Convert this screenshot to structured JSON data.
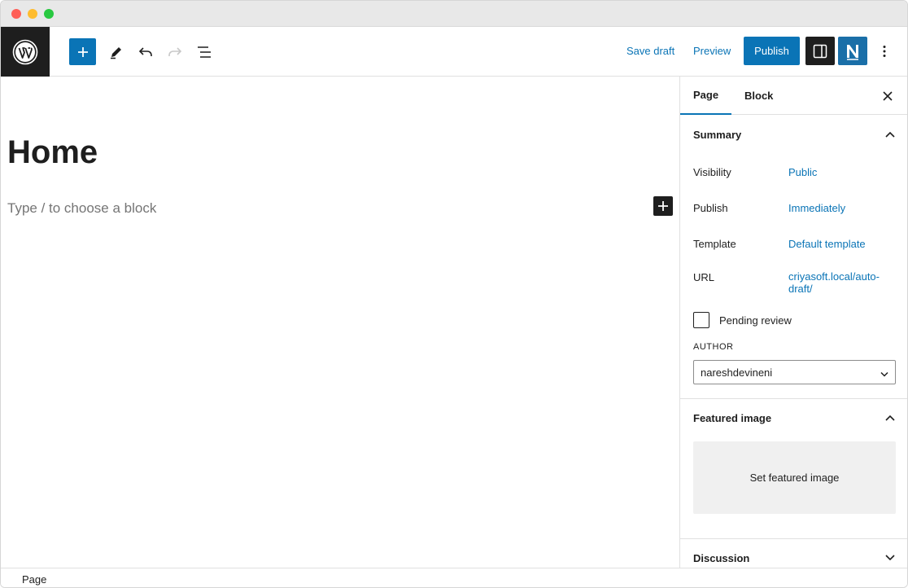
{
  "toolbar": {
    "save_draft": "Save draft",
    "preview": "Preview",
    "publish": "Publish"
  },
  "editor": {
    "title": "Home",
    "placeholder": "Type / to choose a block"
  },
  "sidebar": {
    "tabs": [
      {
        "label": "Page",
        "active": true
      },
      {
        "label": "Block",
        "active": false
      }
    ],
    "summary": {
      "heading": "Summary",
      "rows": [
        {
          "label": "Visibility",
          "value": "Public"
        },
        {
          "label": "Publish",
          "value": "Immediately"
        },
        {
          "label": "Template",
          "value": "Default template"
        },
        {
          "label": "URL",
          "value": "criyasoft.local/auto-draft/"
        }
      ],
      "pending_review": "Pending review",
      "author_label": "AUTHOR",
      "author_value": "nareshdevineni"
    },
    "featured_image": {
      "heading": "Featured image",
      "button": "Set featured image"
    },
    "discussion": {
      "heading": "Discussion"
    }
  },
  "statusbar": {
    "crumb": "Page"
  },
  "colors": {
    "accent": "#0a74b6",
    "dark": "#1e1e1e"
  }
}
